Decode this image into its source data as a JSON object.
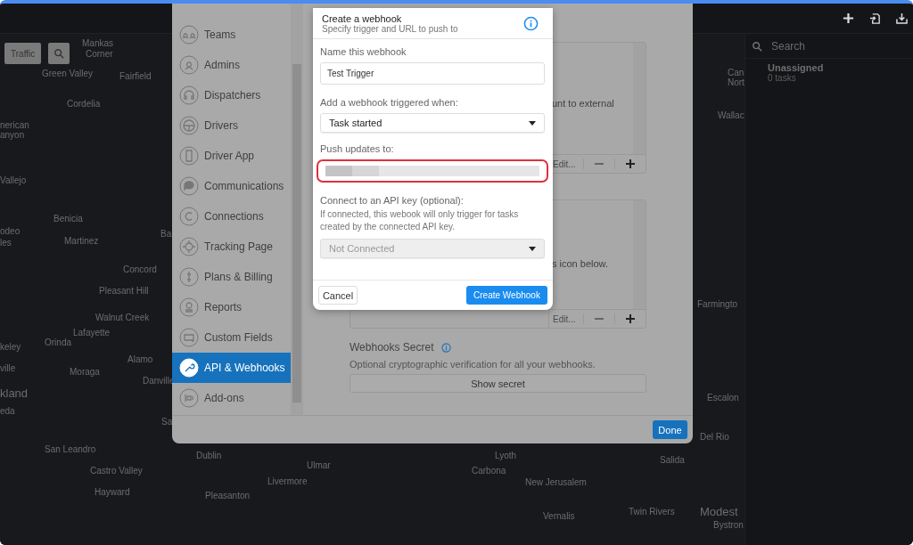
{
  "map": {
    "buttons": [
      {
        "label": "Traffic"
      }
    ],
    "labels": [
      "Mankas",
      "Corner",
      "Green Valley",
      "Fairfield",
      "Can",
      "Nort",
      "Cordelia",
      "Wallac",
      "nerican",
      "anyon",
      "Vallejo",
      "Benicia",
      "odeo",
      "les",
      "Martinez",
      "Ba",
      "Concord",
      "Pleasant Hill",
      "Farmingto",
      "Walnut Creek",
      "Lafayette",
      "keley",
      "Orinda",
      "Alamo",
      "ville",
      "Moraga",
      "Danville",
      "kland",
      "Escalon",
      "eda",
      "Sa",
      "Del Rio",
      "San Leandro",
      "Dublin",
      "Lyoth",
      "Ulmar",
      "Salida",
      "Castro Valley",
      "Carbona",
      "Livermore",
      "New Jerusalem",
      "Hayward",
      "Pleasanton",
      "Vernalis",
      "Twin Rivers",
      "Modest",
      "Bystron"
    ]
  },
  "right_panel": {
    "search": {
      "placeholder": "Search"
    },
    "group": {
      "title": "Unassigned",
      "count": "0 tasks"
    }
  },
  "settings": {
    "nav": [
      {
        "label": "Teams",
        "selected": false
      },
      {
        "label": "Admins",
        "selected": false
      },
      {
        "label": "Dispatchers",
        "selected": false
      },
      {
        "label": "Drivers",
        "selected": false
      },
      {
        "label": "Driver App",
        "selected": false
      },
      {
        "label": "Communications",
        "selected": false
      },
      {
        "label": "Connections",
        "selected": false
      },
      {
        "label": "Tracking Page",
        "selected": false
      },
      {
        "label": "Plans & Billing",
        "selected": false
      },
      {
        "label": "Reports",
        "selected": false
      },
      {
        "label": "Custom Fields",
        "selected": false
      },
      {
        "label": "API & Webhooks",
        "selected": true
      },
      {
        "label": "Add-ons",
        "selected": false
      }
    ],
    "api_box": {
      "text": "unt to external",
      "edit": "Edit..."
    },
    "webhook_box": {
      "text": "s icon below.",
      "edit": "Edit..."
    },
    "secret": {
      "title": "Webhooks Secret",
      "description": "Optional cryptographic verification for all your webhooks.",
      "button": "Show secret"
    },
    "done": "Done"
  },
  "dialog": {
    "title": "Create a webhook",
    "subtitle": "Specify trigger and URL to push to",
    "name_label": "Name this webhook",
    "name_value": "Test Trigger",
    "trigger_label": "Add a webhook triggered when:",
    "trigger_value": "Task started",
    "push_label": "Push updates to:",
    "api_label": "Connect to an API key (optional):",
    "api_help": "If connected, this webook will only trigger for tasks created by the connected API key.",
    "api_value": "Not Connected",
    "api_disabled": true,
    "cancel": "Cancel",
    "create": "Create Webhook"
  }
}
